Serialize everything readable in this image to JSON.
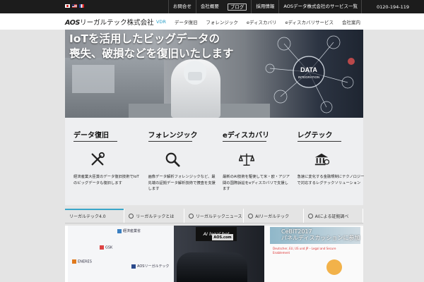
{
  "topbar": {
    "links": [
      "お問合せ",
      "会社概要",
      "ブログ",
      "採用情報",
      "AOSデータ株式会社のサービス一覧"
    ],
    "phone": "0120-194-119"
  },
  "header": {
    "logo_mark": "AOS",
    "logo_text": "リーガルテック株式会社",
    "nav": [
      "VDR",
      "データ復旧",
      "フォレンジック",
      "eディスカバリ",
      "eディスカバリサービス",
      "会社案内"
    ]
  },
  "hero": {
    "line1": "IoTを活用したビッグデータの",
    "line2": "喪失、破損などを復旧いたします",
    "badge_top": "DATA",
    "badge_bottom": "INTEGRATION"
  },
  "services": [
    {
      "title": "データ復旧",
      "icon": "tools-icon",
      "desc": "経済産業大臣賞のデータ復旧技術でIoTのビッグデータも復旧します"
    },
    {
      "title": "フォレンジック",
      "icon": "search-icon",
      "desc": "画像データ解析フォレンジックなど、最先端の証拠データ解析技術で捜査を支援します"
    },
    {
      "title": "eディスカバリ",
      "icon": "scale-icon",
      "desc": "最新のAI技術を駆使して米・欧・アジア間の国際訴訟をeディスカバリで支援します"
    },
    {
      "title": "レグテック",
      "icon": "bank-icon",
      "desc": "急速に変化する金融規制にテクノロジーで対応するレグテックソリューション"
    }
  ],
  "tabs": [
    "リーガルテック4.0",
    "リーガルテックとは",
    "リーガルテックニュース",
    "AIリーガルテック",
    "AIによる証拠調べ"
  ],
  "gallery": {
    "logos": [
      "経済産業省",
      "GSK",
      "ENERES",
      "AOSリーガルテック"
    ],
    "booth_sign": "AI legal bot",
    "booth_badge": "AOS.com",
    "cebit_line1": "CeBIT2017",
    "cebit_line2": "パネルディスカッションに参加",
    "slide_text": "Deutscher, EU, US und JP – Legal and Secure Enablement"
  },
  "colors": {
    "topbar": "#1c1c1c",
    "accent": "#3aa6c9",
    "service_bg": "#eeeff1"
  }
}
